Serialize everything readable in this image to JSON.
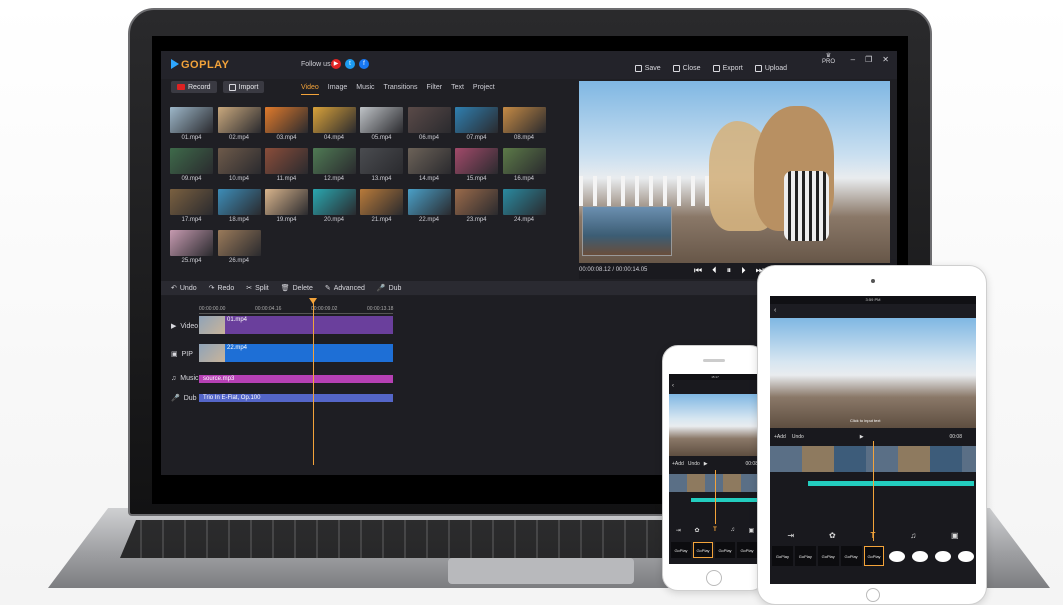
{
  "app": {
    "logo": "GOPLAY",
    "follow_label": "Follow us:",
    "pro_badge": "PRO",
    "top_actions": [
      "Save",
      "Close",
      "Export",
      "Upload"
    ],
    "library_buttons": {
      "record": "Record",
      "import": "Import"
    },
    "tabs": [
      "Video",
      "Image",
      "Music",
      "Transitions",
      "Filter",
      "Text",
      "Project"
    ],
    "active_tab": "Video",
    "media": [
      {
        "label": "01.mp4",
        "color": "#9db7c9"
      },
      {
        "label": "02.mp4",
        "color": "#c9a87d"
      },
      {
        "label": "03.mp4",
        "color": "#e07a2c"
      },
      {
        "label": "04.mp4",
        "color": "#d9a23a"
      },
      {
        "label": "05.mp4",
        "color": "#bfc3c7"
      },
      {
        "label": "06.mp4",
        "color": "#5a4a48"
      },
      {
        "label": "07.mp4",
        "color": "#2f7fb0"
      },
      {
        "label": "08.mp4",
        "color": "#c58a45"
      },
      {
        "label": "09.mp4",
        "color": "#3e6a4a"
      },
      {
        "label": "10.mp4",
        "color": "#6e5a4a"
      },
      {
        "label": "11.mp4",
        "color": "#8a4d3a"
      },
      {
        "label": "12.mp4",
        "color": "#4f7a54"
      },
      {
        "label": "13.mp4",
        "color": "#4a4c50"
      },
      {
        "label": "14.mp4",
        "color": "#6c6258"
      },
      {
        "label": "15.mp4",
        "color": "#a24a6a"
      },
      {
        "label": "16.mp4",
        "color": "#5c7a48"
      },
      {
        "label": "17.mp4",
        "color": "#7a6040"
      },
      {
        "label": "18.mp4",
        "color": "#3d8db8"
      },
      {
        "label": "19.mp4",
        "color": "#d8b48c"
      },
      {
        "label": "20.mp4",
        "color": "#2aa7b0"
      },
      {
        "label": "21.mp4",
        "color": "#b87a3a"
      },
      {
        "label": "22.mp4",
        "color": "#4aa0c8"
      },
      {
        "label": "23.mp4",
        "color": "#9a6a4a"
      },
      {
        "label": "24.mp4",
        "color": "#2a8aa0"
      },
      {
        "label": "25.mp4",
        "color": "#c69ab0"
      },
      {
        "label": "26.mp4",
        "color": "#9a7a5a"
      }
    ],
    "player": {
      "timecode": "00:00:08.12 / 00:00:14.05",
      "controls": [
        "⏮",
        "⏴",
        "⏸",
        "⏵",
        "⏭"
      ]
    },
    "edit_tools": [
      "Undo",
      "Redo",
      "Split",
      "Delete",
      "Advanced",
      "Dub"
    ],
    "ruler_ticks": [
      "00:00:00.00",
      "00:00:04.16",
      "00:00:09.02",
      "00:00:13.18"
    ],
    "tracks": [
      {
        "label": "Video",
        "clip": "01.mp4",
        "color": "#6a3f9c"
      },
      {
        "label": "PIP",
        "clip": "22.mp4",
        "color": "#1e6fd6"
      },
      {
        "label": "Music",
        "clip": "source.mp3",
        "color": "#b640b4"
      },
      {
        "label": "Dub",
        "clip": "Trio In E-Flat, Op.100",
        "color": "#5466c8"
      }
    ]
  },
  "tablet": {
    "status": "3:59 PM",
    "back": "‹",
    "hint": "Click to input text",
    "add": "+Add",
    "undo": "Undo",
    "time": "00:08",
    "fonts": [
      "GoPlay",
      "GoPlay",
      "GoPlay",
      "GoPlay",
      "GoPlay"
    ],
    "text_tool": "T"
  },
  "phone": {
    "status": "15:17",
    "back": "‹",
    "add": "+Add",
    "undo": "Undo",
    "time": "00:08",
    "fonts": [
      "GoPlay",
      "GoPlay",
      "GoPlay",
      "GoPlay"
    ],
    "text_tool": "T"
  }
}
